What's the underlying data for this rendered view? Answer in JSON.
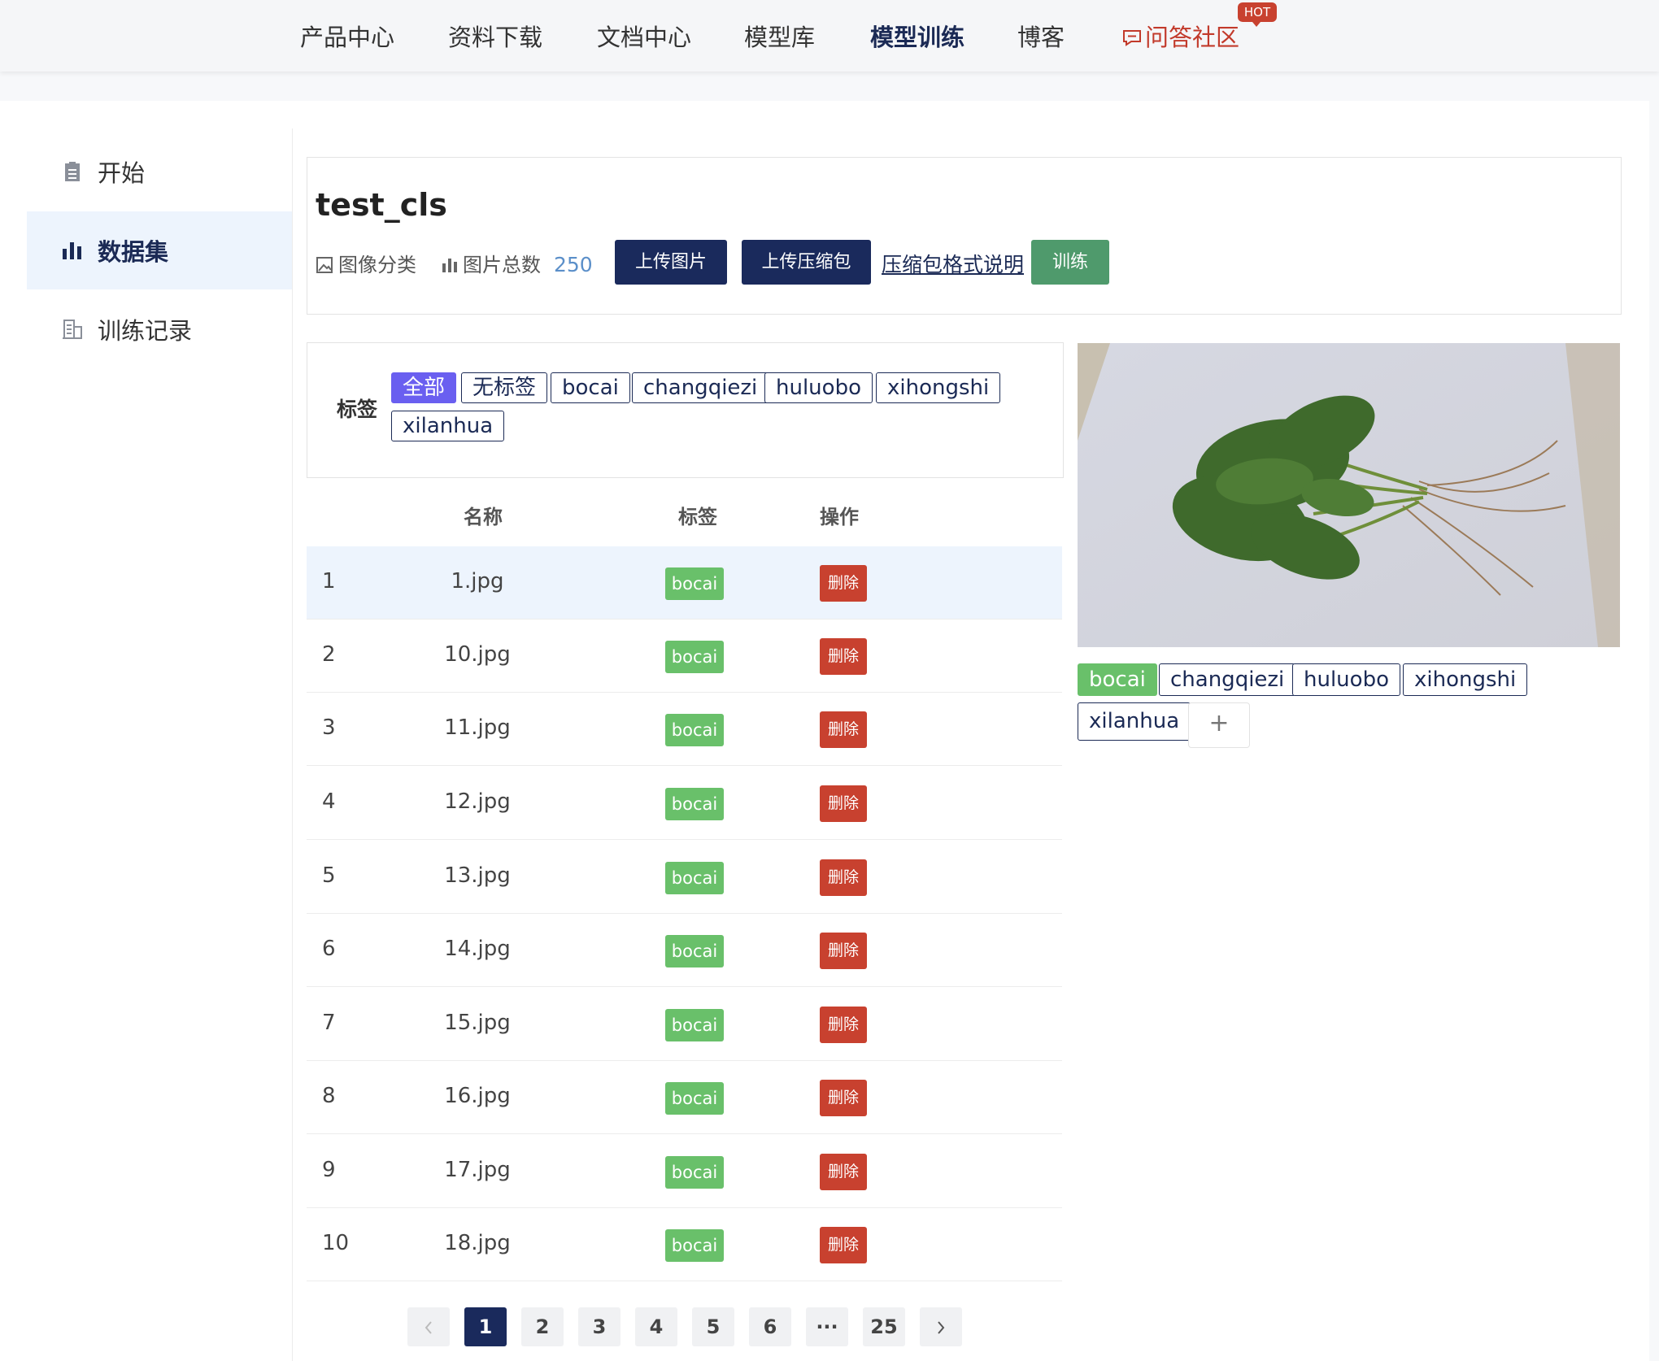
{
  "nav": {
    "items": [
      "产品中心",
      "资料下载",
      "文档中心",
      "模型库",
      "模型训练",
      "博客",
      "问答社区"
    ],
    "active": "模型训练",
    "hot_badge": "HOT"
  },
  "sidebar": {
    "items": [
      {
        "label": "开始",
        "icon": "clipboard-icon"
      },
      {
        "label": "数据集",
        "icon": "bar-chart-icon"
      },
      {
        "label": "训练记录",
        "icon": "building-icon"
      }
    ],
    "active": "数据集"
  },
  "dataset": {
    "title": "test_cls",
    "type_label": "图像分类",
    "total_label": "图片总数",
    "total_count": "250",
    "upload_images": "上传图片",
    "upload_zip": "上传压缩包",
    "zip_format": "压缩包格式说明",
    "train": "训练"
  },
  "filter": {
    "label": "标签",
    "chips": [
      "全部",
      "无标签",
      "bocai",
      "changqiezi",
      "huluobo",
      "xihongshi",
      "xilanhua"
    ],
    "selected": "全部"
  },
  "table": {
    "headers": [
      "名称",
      "标签",
      "操作"
    ],
    "delete_label": "删除",
    "rows": [
      {
        "index": "1",
        "name": "1.jpg",
        "tag": "bocai"
      },
      {
        "index": "2",
        "name": "10.jpg",
        "tag": "bocai"
      },
      {
        "index": "3",
        "name": "11.jpg",
        "tag": "bocai"
      },
      {
        "index": "4",
        "name": "12.jpg",
        "tag": "bocai"
      },
      {
        "index": "5",
        "name": "13.jpg",
        "tag": "bocai"
      },
      {
        "index": "6",
        "name": "14.jpg",
        "tag": "bocai"
      },
      {
        "index": "7",
        "name": "15.jpg",
        "tag": "bocai"
      },
      {
        "index": "8",
        "name": "16.jpg",
        "tag": "bocai"
      },
      {
        "index": "9",
        "name": "17.jpg",
        "tag": "bocai"
      },
      {
        "index": "10",
        "name": "18.jpg",
        "tag": "bocai"
      }
    ]
  },
  "pagination": {
    "pages": [
      "1",
      "2",
      "3",
      "4",
      "5",
      "6",
      "···",
      "25"
    ],
    "current": "1",
    "prev_icon": "chevron-left-icon",
    "next_icon": "chevron-right-icon"
  },
  "preview": {
    "tags": [
      "bocai",
      "changqiezi",
      "huluobo",
      "xihongshi",
      "xilanhua"
    ],
    "selected_tag": "bocai",
    "add_label": "+"
  },
  "colors": {
    "primary": "#1a2a5c",
    "train_green": "#4f9a6c",
    "tag_green": "#69c06a",
    "delete_red": "#c8412f",
    "selected_chip": "#6a5ff0",
    "hot_red": "#c8412f"
  }
}
